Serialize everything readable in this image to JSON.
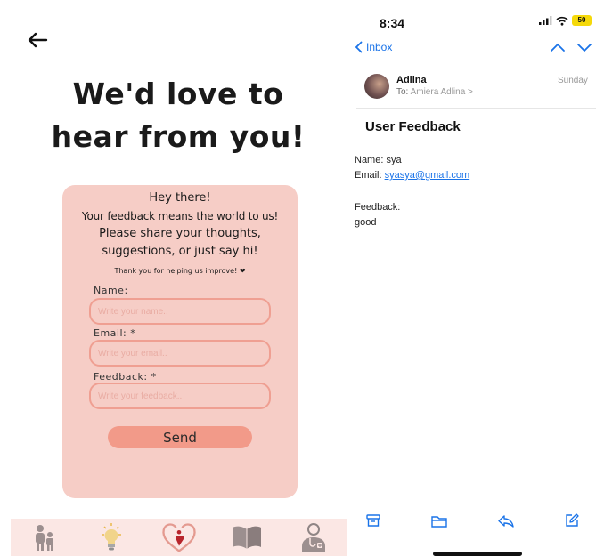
{
  "app": {
    "headline_line1": "We'd love to",
    "headline_line2": "hear from you!",
    "card": {
      "intro_line1": "Hey there!",
      "intro_line2": "Your feedback means the world to us!",
      "intro_line3": "Please share your thoughts,",
      "intro_line4": "suggestions, or just say hi!",
      "thanks": "Thank you for helping us improve! ❤"
    },
    "form": {
      "name_label": "Name:",
      "name_placeholder": "Write your name..",
      "email_label": "Email: *",
      "email_placeholder": "Write your email..",
      "feedback_label": "Feedback: *",
      "feedback_placeholder": "Write your feedback..",
      "send_label": "Send"
    },
    "nav_icons": [
      "family-icon",
      "lightbulb-icon",
      "heart-hands-icon",
      "book-icon",
      "doctor-icon"
    ],
    "colors": {
      "card": "#f6cdc6",
      "accent": "#f29a89",
      "input_border": "#ef9f92",
      "nav_bg": "#fbe7e4"
    }
  },
  "mail": {
    "status_time": "8:34",
    "battery": "50",
    "back_label": "Inbox",
    "sender": "Adlina",
    "to_prefix": "To:",
    "to_name": "Amiera Adlina >",
    "date": "Sunday",
    "subject": "User Feedback",
    "name_line": "Name: sya",
    "email_prefix": "Email:",
    "email_value": "syasya@gmail.com",
    "feedback_heading": "Feedback:",
    "feedback_value": "good",
    "toolbar_icons": [
      "archive-icon",
      "folder-icon",
      "reply-icon",
      "compose-icon"
    ],
    "colors": {
      "link": "#1a73e8"
    }
  }
}
